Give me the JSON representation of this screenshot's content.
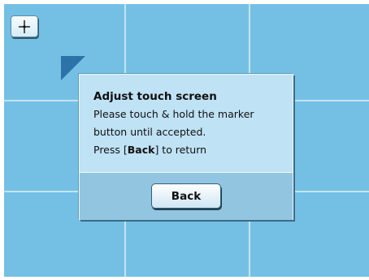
{
  "dialog": {
    "title": "Adjust touch screen",
    "line1": "Please touch & hold the marker",
    "line2": "button until accepted.",
    "line3_prefix": "Press [",
    "line3_bold": "Back",
    "line3_suffix": "] to return"
  },
  "buttons": {
    "back_label": "Back"
  },
  "icons": {
    "marker_button_icon": "crosshair-icon",
    "corner_marker": "triangle-marker-icon"
  },
  "colors": {
    "screen_background": "#74c0e4",
    "grid_lines": "#c4e3f3",
    "dialog_background": "#bfe2f5",
    "dialog_footer": "#92c5df",
    "marker": "#2b73a8"
  }
}
